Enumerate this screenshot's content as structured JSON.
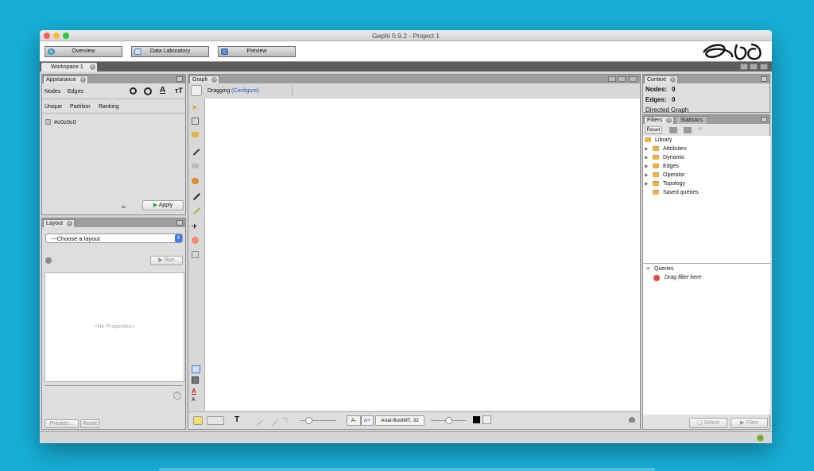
{
  "window": {
    "title": "Gephi 0.9.2 - Project 1"
  },
  "toolbar": {
    "overview": "Overview",
    "data_laboratory": "Data Laboratory",
    "preview": "Preview"
  },
  "workspace_tab": "Workspace 1",
  "appearance": {
    "tab": "Appearance",
    "nodes": "Nodes",
    "edges": "Edges",
    "unique": "Unique",
    "partition": "Partition",
    "ranking": "Ranking",
    "color_value": "#c0c0c0",
    "apply": "Apply",
    "text_icon_a": "A",
    "text_icon_tt": "тT"
  },
  "layout": {
    "tab": "Layout",
    "select": "---Choose a layout",
    "run": "Run",
    "no_properties": "<No Properties>",
    "help": "?",
    "presets": "Presets...",
    "reset": "Reset"
  },
  "graph": {
    "tab": "Graph",
    "dragging": "Dragging",
    "configure": "(Configure)",
    "font_label": "Arial-BoldMT, 32",
    "font_a_minus": "A-",
    "font_a_plus": "A+",
    "text_tool": "T"
  },
  "context": {
    "tab": "Context",
    "nodes_label": "Nodes:",
    "nodes_value": "0",
    "edges_label": "Edges:",
    "edges_value": "0",
    "graph_type": "Directed Graph"
  },
  "filters": {
    "tab_filters": "Filters",
    "tab_statistics": "Statistics",
    "reset": "Reset",
    "library": "Library",
    "items": [
      "Attributes",
      "Dynamic",
      "Edges",
      "Operator",
      "Topology",
      "Saved queries"
    ],
    "queries": "Queries",
    "drag_hint": "Drag filter here",
    "select": "Select",
    "filter": "Filter"
  },
  "colors": {
    "desktop": "#17aed6",
    "panel_bg": "#dedede",
    "header_bg": "#9d9d9d"
  }
}
